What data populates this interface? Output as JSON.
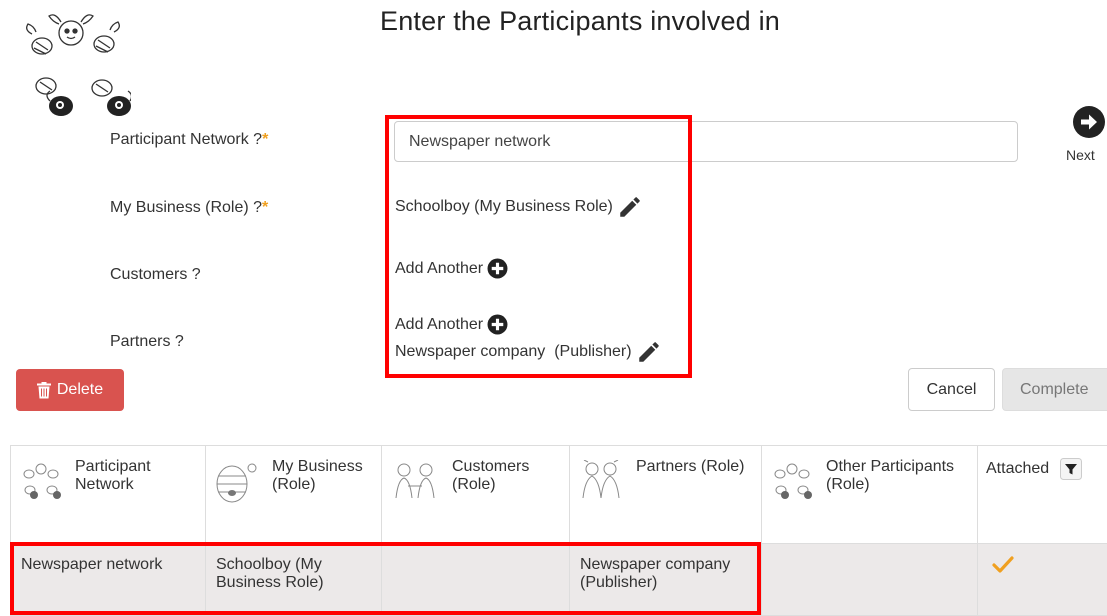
{
  "header": {
    "title": "Enter the Participants involved in",
    "next_label": "Next"
  },
  "form": {
    "network_label": "Participant Network ?",
    "network_value": "Newspaper network",
    "business_label": "My Business (Role) ?",
    "business_value": "Schoolboy (My Business Role)",
    "customers_label": "Customers ?",
    "customers_add": "Add Another",
    "partners_label": "Partners ?",
    "partners_add": "Add Another",
    "partners_value": "Newspaper company  (Publisher)",
    "required_mark": "*"
  },
  "actions": {
    "delete_label": "Delete",
    "cancel_label": "Cancel",
    "complete_label": "Complete"
  },
  "table": {
    "headers": {
      "network": "Participant Network",
      "business": "My Business (Role)",
      "customers": "Customers (Role)",
      "partners": "Partners (Role)",
      "other": "Other Participants (Role)",
      "attached": "Attached"
    },
    "rows": [
      {
        "network": "Newspaper network",
        "business": "Schoolboy (My Business Role)",
        "customers": "",
        "partners": "Newspaper company (Publisher)",
        "other": "",
        "attached": true
      }
    ]
  },
  "colors": {
    "highlight": "#ff0000",
    "delete": "#d9534f",
    "required": "#f0a020",
    "check": "#f0a020"
  },
  "icons": [
    "bee-logo-icon",
    "next-arrow-icon",
    "pencil-icon",
    "plus-circle-icon",
    "trash-icon",
    "filter-icon",
    "check-icon"
  ]
}
